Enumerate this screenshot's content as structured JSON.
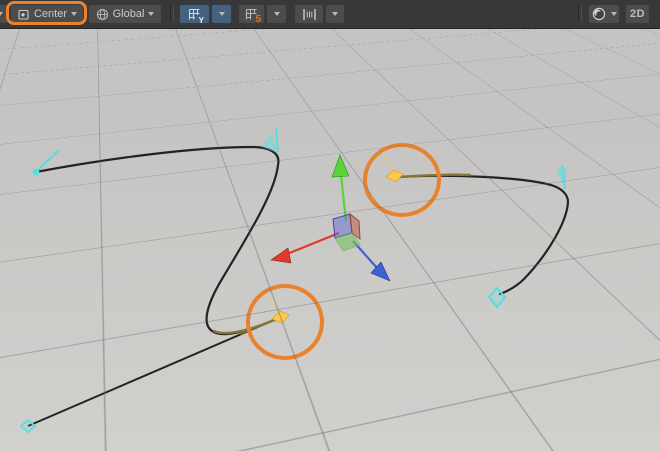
{
  "toolbar": {
    "overflow_button": {
      "icon": "chevron-down-icon"
    },
    "pivot_button": {
      "label": "Center",
      "icon": "pivot-center-icon"
    },
    "orientation_button": {
      "label": "Global",
      "icon": "globe-icon"
    },
    "grid_visibility_button": {
      "axis_label": "Y",
      "icon": "grid-icon",
      "active": true
    },
    "grid_snap_button": {
      "badge": "5",
      "icon": "grid-icon"
    },
    "snap_increment_button": {
      "icon": "snap-increment-icon"
    },
    "shading_mode_button": {
      "icon": "shaded-sphere-icon"
    },
    "mode_2d_button": {
      "label": "2D"
    }
  },
  "scene": {
    "spline": {
      "curve_color": "#232323",
      "selected_segment_color": "#85743a",
      "handle_color": "#55dde2",
      "handle_flag_fill": "rgba(90,221,226,0.5)",
      "selected_knot_color": "#fec84a",
      "selected_knot_tangent_color": "rgba(250,205,90,0.55)"
    },
    "gizmo": {
      "x_color": "#e03a2c",
      "y_color": "#5ad437",
      "z_color": "#3b63d6",
      "plane_front_fill": "rgba(100,105,215,0.5)",
      "plane_right_fill": "rgba(185,95,75,0.55)",
      "plane_bottom_fill": "rgba(120,195,95,0.6)"
    },
    "annotation_color": "#e8822d"
  }
}
